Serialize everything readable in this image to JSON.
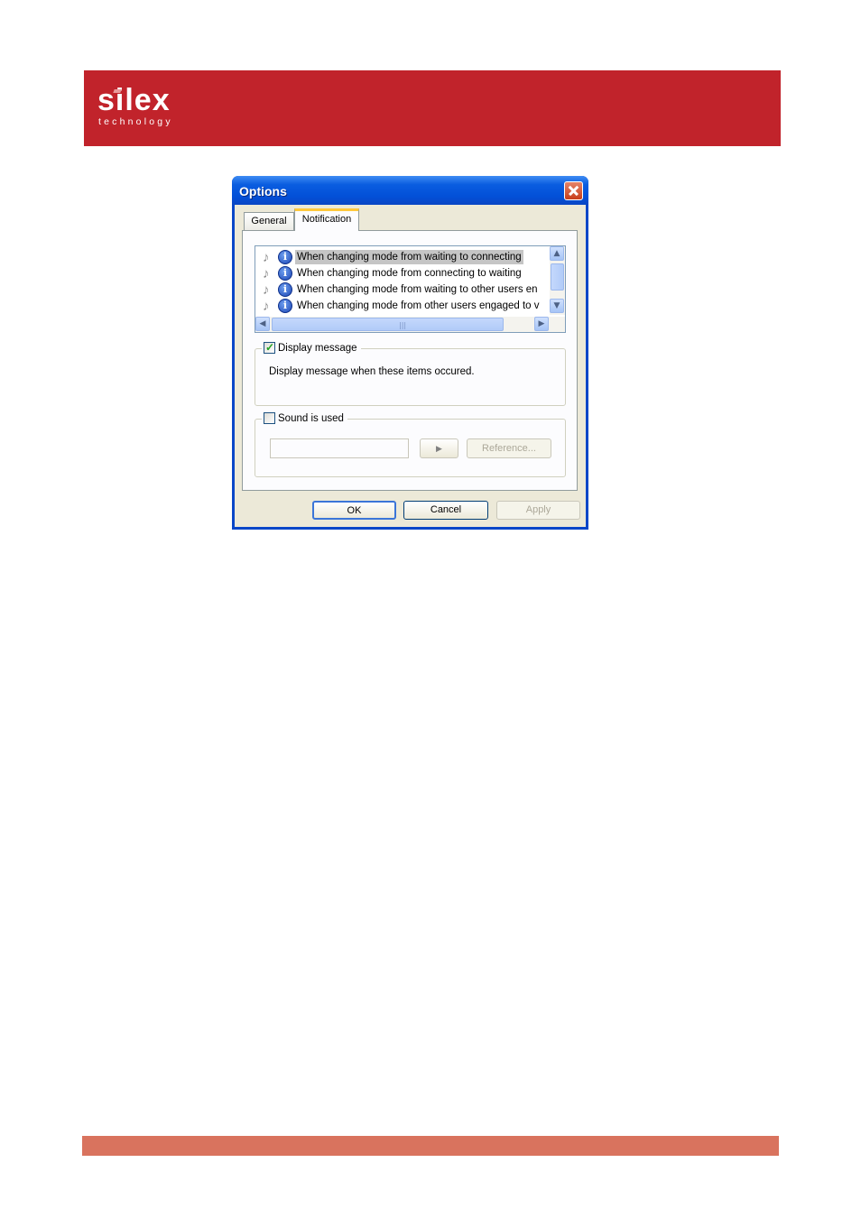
{
  "brand": {
    "logo_main": "silex",
    "logo_sub": "technology",
    "header_color": "#c1232b",
    "footer_color": "#d9735e"
  },
  "dialog": {
    "title": "Options",
    "tabs": [
      {
        "label": "General",
        "active": false
      },
      {
        "label": "Notification",
        "active": true
      }
    ],
    "events": [
      {
        "text": "When changing mode from waiting to connecting",
        "selected": true
      },
      {
        "text": "When changing mode from connecting to waiting",
        "selected": false
      },
      {
        "text": "When changing mode from waiting to other users en",
        "selected": false
      },
      {
        "text": "When changing mode from other users engaged to v",
        "selected": false
      }
    ],
    "display_message": {
      "label": "Display message",
      "checked": true,
      "description": "Display message when these items occured."
    },
    "sound": {
      "label": "Sound is used",
      "checked": false,
      "file_value": "",
      "play_label": "▶",
      "reference_label": "Reference..."
    },
    "buttons": {
      "ok": "OK",
      "cancel": "Cancel",
      "apply": "Apply"
    }
  }
}
